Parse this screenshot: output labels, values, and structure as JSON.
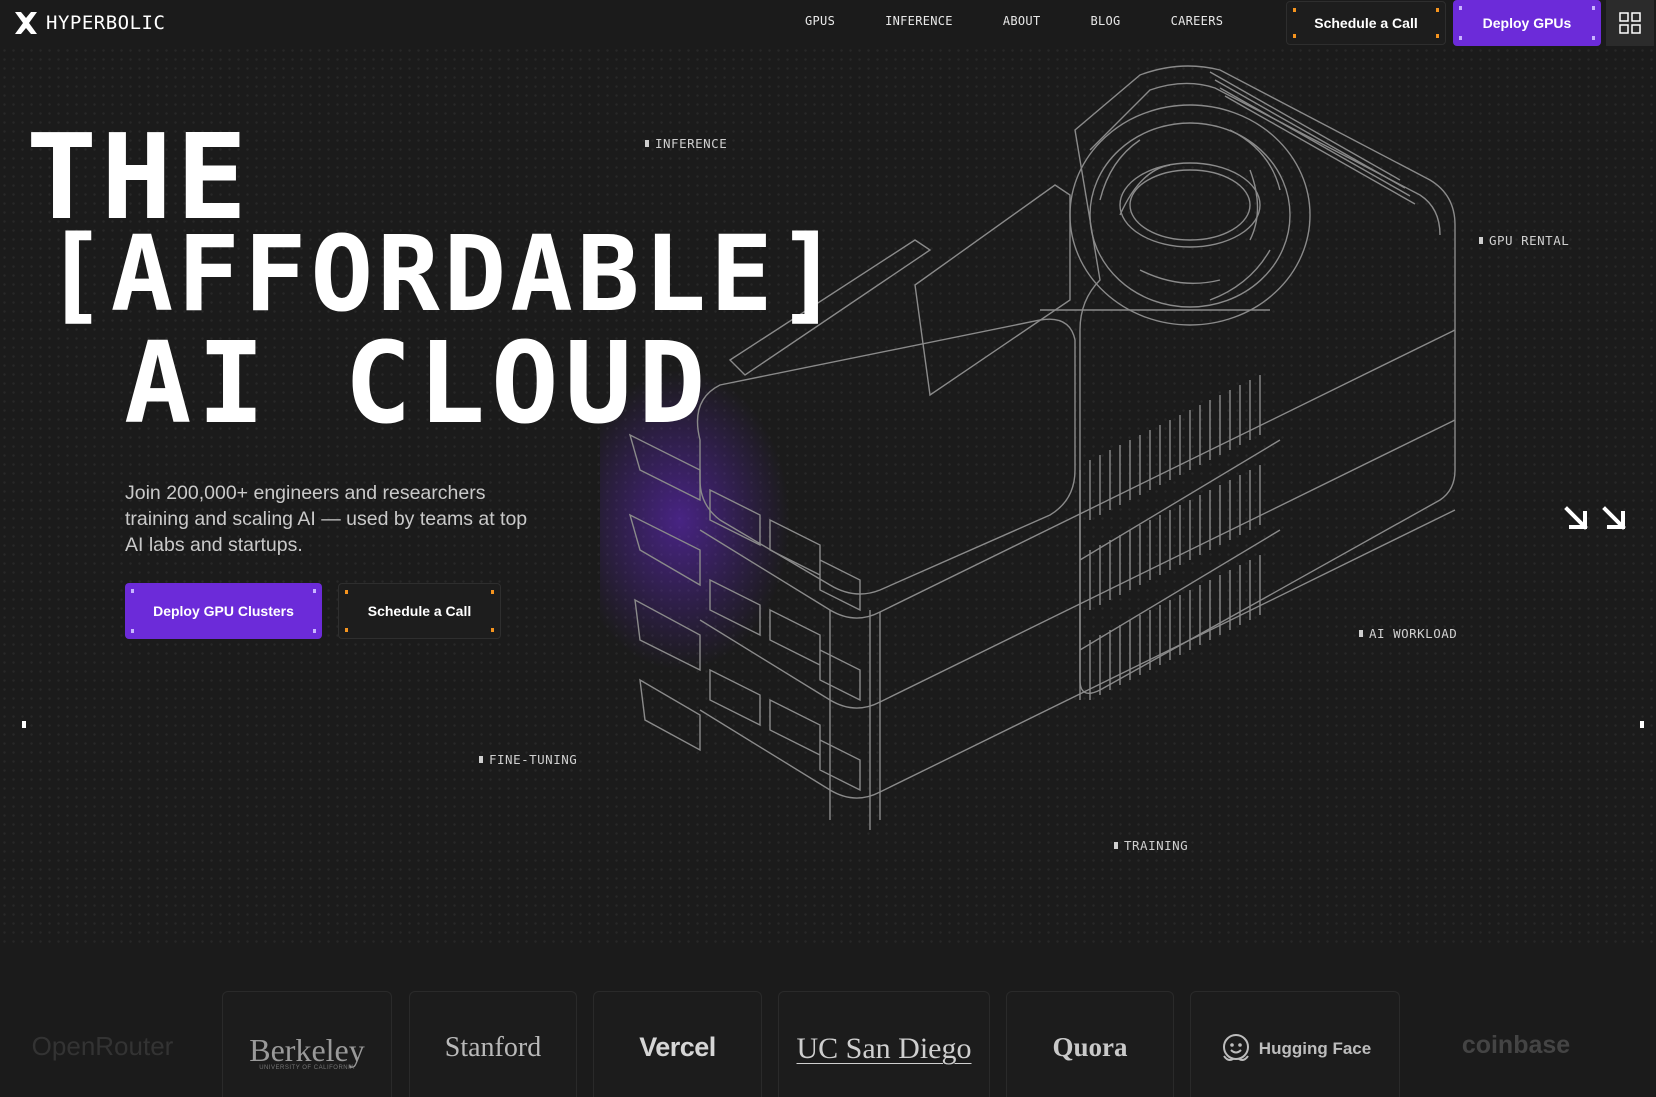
{
  "brand": {
    "name": "HYPERBOLIC",
    "accent": "#6c2bd9",
    "corner_accent": "#f5941e"
  },
  "nav": {
    "links": [
      "GPUS",
      "INFERENCE",
      "ABOUT",
      "BLOG",
      "CAREERS"
    ],
    "schedule_label": "Schedule a Call",
    "deploy_label": "Deploy GPUs",
    "menu_icon": "grid-icon"
  },
  "hero": {
    "line1": "THE",
    "line2": "[AFFORDABLE]",
    "line3": "AI CLOUD",
    "subtitle": "Join 200,000+ engineers and researchers training and scaling AI — used by teams at top AI labs and startups.",
    "cta_primary": "Deploy GPU Clusters",
    "cta_secondary": "Schedule a Call"
  },
  "tags": {
    "inference": "INFERENCE",
    "gpu_rental": "GPU RENTAL",
    "ai_workload": "AI WORKLOAD",
    "fine_tuning": "FINE-TUNING",
    "training": "TRAINING"
  },
  "partners": {
    "openrouter": "OpenRouter",
    "berkeley": "Berkeley",
    "berkeley_sub": "UNIVERSITY OF CALIFORNIA",
    "stanford": "Stanford",
    "vercel": "Vercel",
    "ucsd": "UC San Diego",
    "quora": "Quora",
    "huggingface": "Hugging Face",
    "coinbase": "coinbase"
  }
}
